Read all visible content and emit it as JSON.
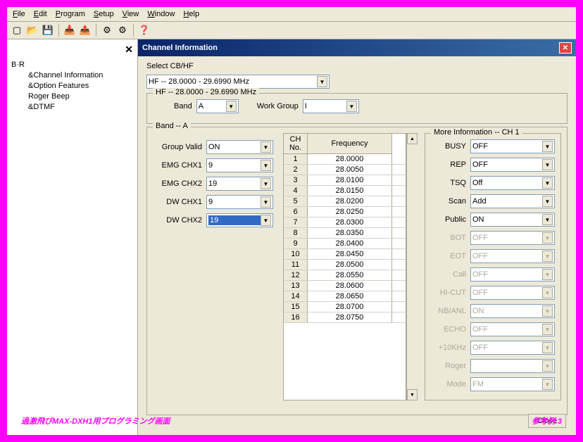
{
  "menu": {
    "file": "File",
    "edit": "Edit",
    "program": "Program",
    "setup": "Setup",
    "view": "View",
    "window": "Window",
    "help": "Help"
  },
  "tree": {
    "root": "B·R",
    "items": [
      "&Channel Information",
      "&Option Features",
      "Roger Beep",
      "&DTMF"
    ]
  },
  "dialog": {
    "title": "Channel Information",
    "select_label": "Select CB/HF",
    "select_value": "HF -- 28.0000 - 29.6990 MHz",
    "hf_legend": "HF -- 28.0000 - 29.6990 MHz",
    "band_label": "Band",
    "band_value": "A",
    "wg_label": "Work Group",
    "wg_value": "I",
    "band_a_legend": "Band -- A",
    "left": {
      "group_valid": {
        "label": "Group Valid",
        "value": "ON"
      },
      "emg_chx1": {
        "label": "EMG CHX1",
        "value": "9"
      },
      "emg_chx2": {
        "label": "EMG CHX2",
        "value": "19"
      },
      "dw_chx1": {
        "label": "DW CHX1",
        "value": "9"
      },
      "dw_chx2": {
        "label": "DW CHX2",
        "value": "19"
      }
    },
    "table": {
      "ch_head": "CH No.",
      "freq_head": "Frequency",
      "rows": [
        {
          "ch": "1",
          "f": "28.0000"
        },
        {
          "ch": "2",
          "f": "28.0050"
        },
        {
          "ch": "3",
          "f": "28.0100"
        },
        {
          "ch": "4",
          "f": "28.0150"
        },
        {
          "ch": "5",
          "f": "28.0200"
        },
        {
          "ch": "6",
          "f": "28.0250"
        },
        {
          "ch": "7",
          "f": "28.0300"
        },
        {
          "ch": "8",
          "f": "28.0350"
        },
        {
          "ch": "9",
          "f": "28.0400"
        },
        {
          "ch": "10",
          "f": "28.0450"
        },
        {
          "ch": "11",
          "f": "28.0500"
        },
        {
          "ch": "12",
          "f": "28.0550"
        },
        {
          "ch": "13",
          "f": "28.0600"
        },
        {
          "ch": "14",
          "f": "28.0650"
        },
        {
          "ch": "15",
          "f": "28.0700"
        },
        {
          "ch": "16",
          "f": "28.0750"
        }
      ]
    },
    "more": {
      "legend": "More Information -- CH 1",
      "busy": {
        "label": "BUSY",
        "value": "OFF",
        "enabled": true
      },
      "rep": {
        "label": "REP",
        "value": "OFF",
        "enabled": true
      },
      "tsq": {
        "label": "TSQ",
        "value": "Off",
        "enabled": true
      },
      "scan": {
        "label": "Scan",
        "value": "Add",
        "enabled": true
      },
      "public": {
        "label": "Public",
        "value": "ON",
        "enabled": true
      },
      "bot": {
        "label": "BOT",
        "value": "OFF",
        "enabled": false
      },
      "eot": {
        "label": "EOT",
        "value": "OFF",
        "enabled": false
      },
      "call": {
        "label": "Call",
        "value": "OFF",
        "enabled": false
      },
      "hicut": {
        "label": "HI-CUT",
        "value": "OFF",
        "enabled": false
      },
      "nbanl": {
        "label": "NB/ANL",
        "value": "ON",
        "enabled": false
      },
      "echo": {
        "label": "ECHO",
        "value": "OFF",
        "enabled": false
      },
      "p10khz": {
        "label": "+10KHz",
        "value": "OFF",
        "enabled": false
      },
      "roger": {
        "label": "Roger",
        "value": "",
        "enabled": false
      },
      "mode": {
        "label": "Mode",
        "value": "FM",
        "enabled": false
      }
    },
    "close_btn": "Close"
  },
  "caption": {
    "left": "過激飛びMAX-DXH1用プログラミング画面",
    "right": "参考例:3"
  }
}
